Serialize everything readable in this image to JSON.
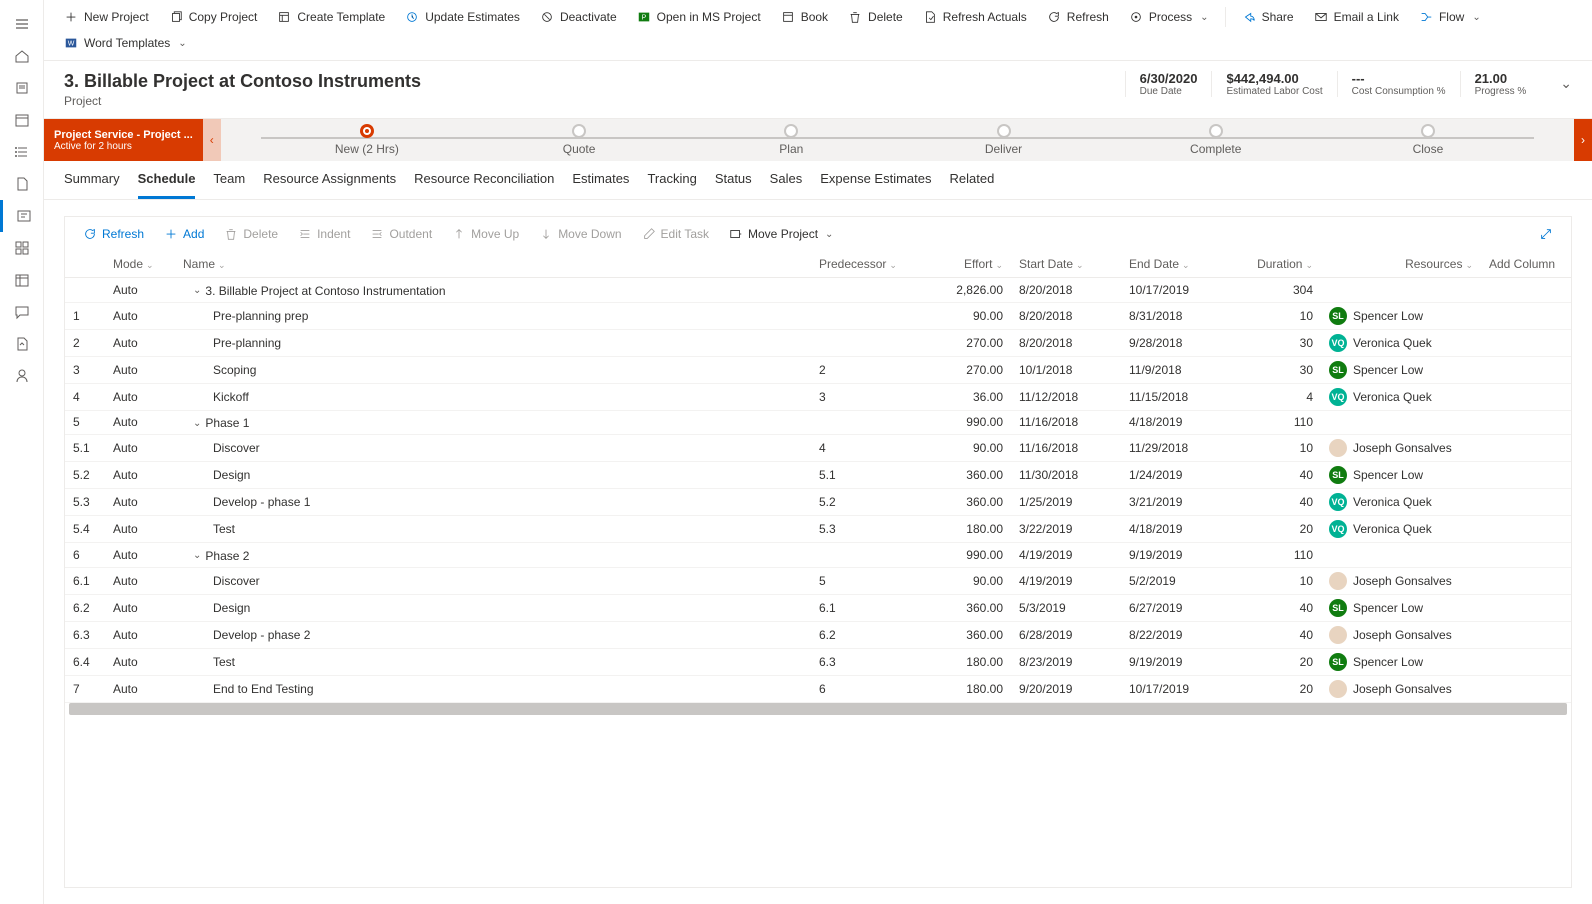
{
  "commandbar": [
    {
      "icon": "plus",
      "label": "New Project"
    },
    {
      "icon": "copy",
      "label": "Copy Project"
    },
    {
      "icon": "template",
      "label": "Create Template"
    },
    {
      "icon": "update",
      "label": "Update Estimates"
    },
    {
      "icon": "deactivate",
      "label": "Deactivate"
    },
    {
      "icon": "excel",
      "label": "Open in MS Project"
    },
    {
      "icon": "book",
      "label": "Book"
    },
    {
      "icon": "delete",
      "label": "Delete"
    },
    {
      "icon": "refresh-actuals",
      "label": "Refresh Actuals"
    },
    {
      "icon": "refresh",
      "label": "Refresh"
    },
    {
      "icon": "process",
      "label": "Process",
      "dropdown": true
    },
    {
      "sep": true
    },
    {
      "icon": "share",
      "label": "Share"
    },
    {
      "icon": "email",
      "label": "Email a Link"
    },
    {
      "icon": "flow",
      "label": "Flow",
      "dropdown": true
    },
    {
      "icon": "word",
      "label": "Word Templates",
      "dropdown": true
    }
  ],
  "header": {
    "title": "3. Billable Project at Contoso Instruments",
    "subtitle": "Project",
    "metrics": [
      {
        "value": "6/30/2020",
        "label": "Due Date"
      },
      {
        "value": "$442,494.00",
        "label": "Estimated Labor Cost"
      },
      {
        "value": "---",
        "label": "Cost Consumption %"
      },
      {
        "value": "21.00",
        "label": "Progress %"
      }
    ]
  },
  "stagebar": {
    "badge_line1": "Project Service - Project ...",
    "badge_line2": "Active for 2 hours",
    "stages": [
      {
        "label": "New  (2 Hrs)",
        "active": true
      },
      {
        "label": "Quote"
      },
      {
        "label": "Plan"
      },
      {
        "label": "Deliver"
      },
      {
        "label": "Complete"
      },
      {
        "label": "Close"
      }
    ]
  },
  "tabs": [
    "Summary",
    "Schedule",
    "Team",
    "Resource Assignments",
    "Resource Reconciliation",
    "Estimates",
    "Tracking",
    "Status",
    "Sales",
    "Expense Estimates",
    "Related"
  ],
  "activeTab": 1,
  "gridToolbar": {
    "refresh": "Refresh",
    "add": "Add",
    "delete": "Delete",
    "indent": "Indent",
    "outdent": "Outdent",
    "moveup": "Move Up",
    "movedown": "Move Down",
    "edit": "Edit Task",
    "moveproject": "Move Project"
  },
  "columns": [
    "",
    "Mode",
    "Name",
    "Predecessor",
    "Effort",
    "Start Date",
    "End Date",
    "Duration",
    "Resources",
    "Add Column"
  ],
  "rows": [
    {
      "num": "",
      "mode": "Auto",
      "name": "3. Billable Project at Contoso Instrumentation",
      "indent": 0,
      "expand": true,
      "pred": "",
      "effort": "2,826.00",
      "start": "8/20/2018",
      "end": "10/17/2019",
      "dur": "304",
      "res": ""
    },
    {
      "num": "1",
      "mode": "Auto",
      "name": "Pre-planning prep",
      "indent": 1,
      "pred": "",
      "effort": "90.00",
      "start": "8/20/2018",
      "end": "8/31/2018",
      "dur": "10",
      "res": "Spencer Low",
      "avatar": "sl"
    },
    {
      "num": "2",
      "mode": "Auto",
      "name": "Pre-planning",
      "indent": 1,
      "pred": "",
      "effort": "270.00",
      "start": "8/20/2018",
      "end": "9/28/2018",
      "dur": "30",
      "res": "Veronica Quek",
      "avatar": "vq"
    },
    {
      "num": "3",
      "mode": "Auto",
      "name": "Scoping",
      "indent": 1,
      "pred": "2",
      "effort": "270.00",
      "start": "10/1/2018",
      "end": "11/9/2018",
      "dur": "30",
      "res": "Spencer Low",
      "avatar": "sl"
    },
    {
      "num": "4",
      "mode": "Auto",
      "name": "Kickoff",
      "indent": 1,
      "pred": "3",
      "effort": "36.00",
      "start": "11/12/2018",
      "end": "11/15/2018",
      "dur": "4",
      "res": "Veronica Quek",
      "avatar": "vq"
    },
    {
      "num": "5",
      "mode": "Auto",
      "name": "Phase 1",
      "indent": 0,
      "expand": true,
      "pred": "",
      "effort": "990.00",
      "start": "11/16/2018",
      "end": "4/18/2019",
      "dur": "110",
      "res": ""
    },
    {
      "num": "5.1",
      "mode": "Auto",
      "name": "Discover",
      "indent": 1,
      "pred": "4",
      "effort": "90.00",
      "start": "11/16/2018",
      "end": "11/29/2018",
      "dur": "10",
      "res": "Joseph Gonsalves",
      "avatar": "jg"
    },
    {
      "num": "5.2",
      "mode": "Auto",
      "name": "Design",
      "indent": 1,
      "pred": "5.1",
      "effort": "360.00",
      "start": "11/30/2018",
      "end": "1/24/2019",
      "dur": "40",
      "res": "Spencer Low",
      "avatar": "sl"
    },
    {
      "num": "5.3",
      "mode": "Auto",
      "name": "Develop - phase 1",
      "indent": 1,
      "pred": "5.2",
      "effort": "360.00",
      "start": "1/25/2019",
      "end": "3/21/2019",
      "dur": "40",
      "res": "Veronica Quek",
      "avatar": "vq"
    },
    {
      "num": "5.4",
      "mode": "Auto",
      "name": "Test",
      "indent": 1,
      "pred": "5.3",
      "effort": "180.00",
      "start": "3/22/2019",
      "end": "4/18/2019",
      "dur": "20",
      "res": "Veronica Quek",
      "avatar": "vq"
    },
    {
      "num": "6",
      "mode": "Auto",
      "name": "Phase 2",
      "indent": 0,
      "expand": true,
      "pred": "",
      "effort": "990.00",
      "start": "4/19/2019",
      "end": "9/19/2019",
      "dur": "110",
      "res": ""
    },
    {
      "num": "6.1",
      "mode": "Auto",
      "name": "Discover",
      "indent": 1,
      "pred": "5",
      "effort": "90.00",
      "start": "4/19/2019",
      "end": "5/2/2019",
      "dur": "10",
      "res": "Joseph Gonsalves",
      "avatar": "jg"
    },
    {
      "num": "6.2",
      "mode": "Auto",
      "name": "Design",
      "indent": 1,
      "pred": "6.1",
      "effort": "360.00",
      "start": "5/3/2019",
      "end": "6/27/2019",
      "dur": "40",
      "res": "Spencer Low",
      "avatar": "sl"
    },
    {
      "num": "6.3",
      "mode": "Auto",
      "name": "Develop - phase 2",
      "indent": 1,
      "pred": "6.2",
      "effort": "360.00",
      "start": "6/28/2019",
      "end": "8/22/2019",
      "dur": "40",
      "res": "Joseph Gonsalves",
      "avatar": "jg"
    },
    {
      "num": "6.4",
      "mode": "Auto",
      "name": "Test",
      "indent": 1,
      "pred": "6.3",
      "effort": "180.00",
      "start": "8/23/2019",
      "end": "9/19/2019",
      "dur": "20",
      "res": "Spencer Low",
      "avatar": "sl"
    },
    {
      "num": "7",
      "mode": "Auto",
      "name": "End to End Testing",
      "indent": 1,
      "pred": "6",
      "effort": "180.00",
      "start": "9/20/2019",
      "end": "10/17/2019",
      "dur": "20",
      "res": "Joseph Gonsalves",
      "avatar": "jg"
    }
  ]
}
